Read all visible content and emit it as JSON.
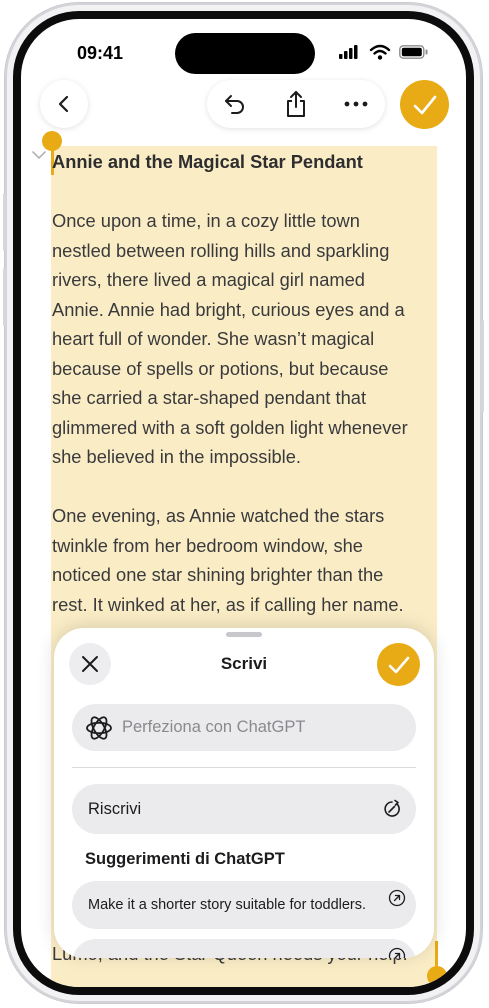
{
  "status": {
    "time": "09:41"
  },
  "toolbar": {
    "back_icon": "chevron-left-icon",
    "undo_icon": "undo-icon",
    "share_icon": "share-icon",
    "more_icon": "ellipsis-icon",
    "done_icon": "checkmark-icon"
  },
  "document": {
    "title": "Annie and the Magical Star Pendant",
    "paragraph1": [
      "Once upon a time, in a cozy little town",
      "nestled between rolling hills and sparkling",
      "rivers, there lived a magical girl named",
      "Annie. Annie had bright, curious eyes and a",
      "heart full of wonder. She wasn’t magical",
      "because of spells or potions, but because",
      "she carried a star-shaped pendant that",
      "glimmered with a soft golden light whenever",
      "she believed in the impossible."
    ],
    "paragraph2": [
      "One evening, as Annie watched the stars",
      "twinkle from her bedroom window, she",
      "noticed one star shining brighter than the",
      "rest. It winked at her, as if calling her name."
    ],
    "last_line": "Lumo, and the Star Queen needs your help!\""
  },
  "sheet": {
    "title": "Scrivi",
    "input_placeholder": "Perfeziona con ChatGPT",
    "rewrite_label": "Riscrivi",
    "suggestions_title": "Suggerimenti di ChatGPT",
    "suggestions": [
      "Make it a shorter story suitable for toddlers."
    ]
  },
  "colors": {
    "accent": "#e8ab16",
    "highlight": "#faedc6",
    "sheet_bg": "#ffffff",
    "row_bg": "#ebebee"
  }
}
